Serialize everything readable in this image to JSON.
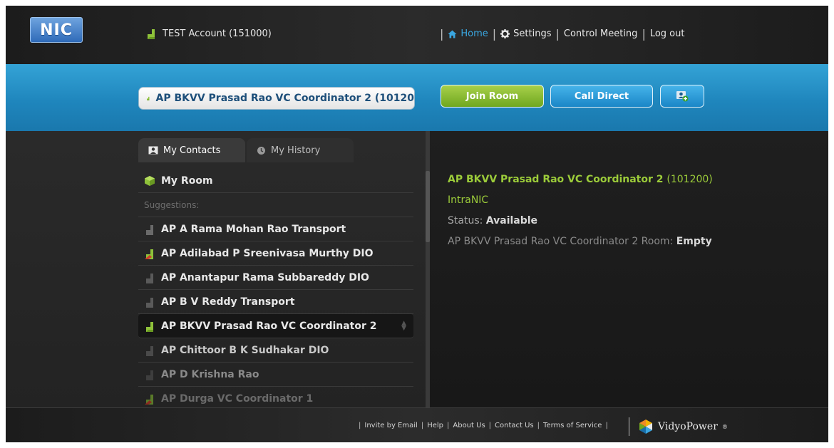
{
  "header": {
    "logo_text": "NIC",
    "account_label": "TEST Account (151000)",
    "nav": {
      "home": "Home",
      "settings": "Settings",
      "control_meeting": "Control Meeting",
      "logout": "Log out"
    }
  },
  "search": {
    "value": "AP BKVV Prasad Rao VC Coordinator 2 (10120"
  },
  "actions": {
    "join_room": "Join Room",
    "call_direct": "Call Direct"
  },
  "tabs": {
    "contacts": "My Contacts",
    "history": "My History"
  },
  "contacts": {
    "my_room": "My Room",
    "suggestions_label": "Suggestions:",
    "items": [
      {
        "name": "AP A Rama Mohan Rao Transport",
        "status_color": "#8a8a8a"
      },
      {
        "name": "AP Adilabad P Sreenivasa Murthy DIO",
        "status_color": "#d03a2a"
      },
      {
        "name": "AP Anantapur Rama Subbareddy DIO",
        "status_color": "#8a8a8a"
      },
      {
        "name": "AP B V Reddy Transport",
        "status_color": "#8a8a8a"
      },
      {
        "name": "AP BKVV Prasad Rao VC Coordinator 2",
        "status_color": "#8fc23a"
      },
      {
        "name": "AP Chittoor B K Sudhakar DIO",
        "status_color": "#8a8a8a"
      },
      {
        "name": "AP D Krishna Rao",
        "status_color": "#8a8a8a"
      },
      {
        "name": "AP Durga VC Coordinator 1",
        "status_color": "#d03a2a"
      }
    ]
  },
  "detail": {
    "name": "AP BKVV Prasad Rao VC Coordinator 2",
    "extension": "(101200)",
    "org": "IntraNIC",
    "status_label": "Status:",
    "status_value": "Available",
    "room_label": "AP BKVV Prasad Rao VC Coordinator 2 Room:",
    "room_value": "Empty"
  },
  "footer": {
    "links": [
      "Invite by Email",
      "Help",
      "About Us",
      "Contact Us",
      "Terms of Service"
    ],
    "brand": "VidyoPower",
    "brand_mark": "®"
  },
  "colors": {
    "accent_blue": "#1f86bd",
    "accent_green": "#9ccc3a",
    "nav_active": "#3aa6e0"
  }
}
